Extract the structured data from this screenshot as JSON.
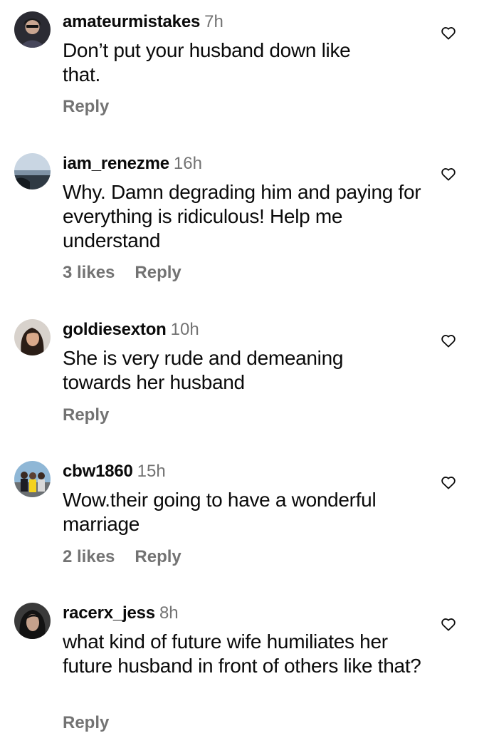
{
  "comments": [
    {
      "username": "amateurmistakes",
      "time": "7h",
      "text": "Don’t put your husband down like that.",
      "likes": "",
      "reply_label": "Reply",
      "avatar_icon": "user-avatar-icon",
      "like_icon": "heart-outline-icon"
    },
    {
      "username": "iam_renezme",
      "time": "16h",
      "text": "Why. Damn degrading him and paying for everything is ridiculous! Help me understand",
      "likes": "3 likes",
      "reply_label": "Reply",
      "avatar_icon": "user-avatar-icon",
      "like_icon": "heart-outline-icon"
    },
    {
      "username": "goldiesexton",
      "time": "10h",
      "text": "She is very rude and demeaning towards her husband",
      "likes": "",
      "reply_label": "Reply",
      "avatar_icon": "user-avatar-icon",
      "like_icon": "heart-outline-icon"
    },
    {
      "username": "cbw1860",
      "time": "15h",
      "text": "Wow.their going to have a wonderful marriage",
      "likes": "2 likes",
      "reply_label": "Reply",
      "avatar_icon": "user-avatar-icon",
      "like_icon": "heart-outline-icon"
    },
    {
      "username": "racerx_jess",
      "time": "8h",
      "text": "what kind of future wife humiliates her future husband in front of others like that?",
      "likes": "",
      "reply_label": "Reply",
      "avatar_icon": "user-avatar-icon",
      "like_icon": "heart-outline-icon"
    }
  ],
  "colors": {
    "text": "#0a0a0a",
    "secondary": "#737373",
    "background": "#ffffff"
  }
}
